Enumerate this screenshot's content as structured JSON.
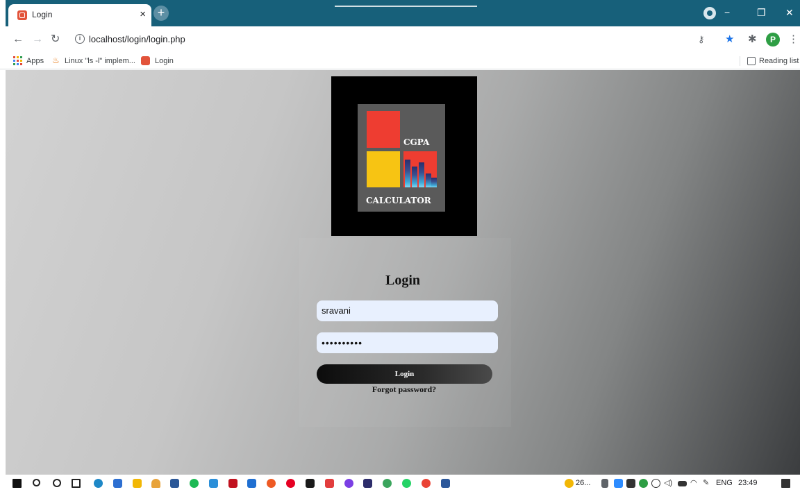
{
  "browser": {
    "tab_title": "Login",
    "tab_close": "×",
    "new_tab": "+",
    "url": "localhost/login/login.php",
    "avatar_letter": "P",
    "window_controls": {
      "minimize": "−",
      "restore": "❐",
      "close": "✕"
    }
  },
  "bookmarks": {
    "apps_label": "Apps",
    "items": [
      {
        "label": "Linux \"ls -l\" implem...",
        "icon": "java-icon"
      },
      {
        "label": "Login",
        "icon": "xampp-icon"
      }
    ],
    "reading_list_label": "Reading list"
  },
  "logo": {
    "line1": "CGPA",
    "line2": "CALCULATOR",
    "colors": {
      "red": "#ee3d31",
      "yellow": "#f7c413",
      "panel": "#5a5a5a"
    }
  },
  "form": {
    "title": "Login",
    "username_value": "sravani",
    "password_value": "••••••••••",
    "login_button": "Login",
    "forgot_link": "Forgot password?"
  },
  "taskbar": {
    "weather": "26...",
    "language": "ENG",
    "time": "23:49"
  }
}
